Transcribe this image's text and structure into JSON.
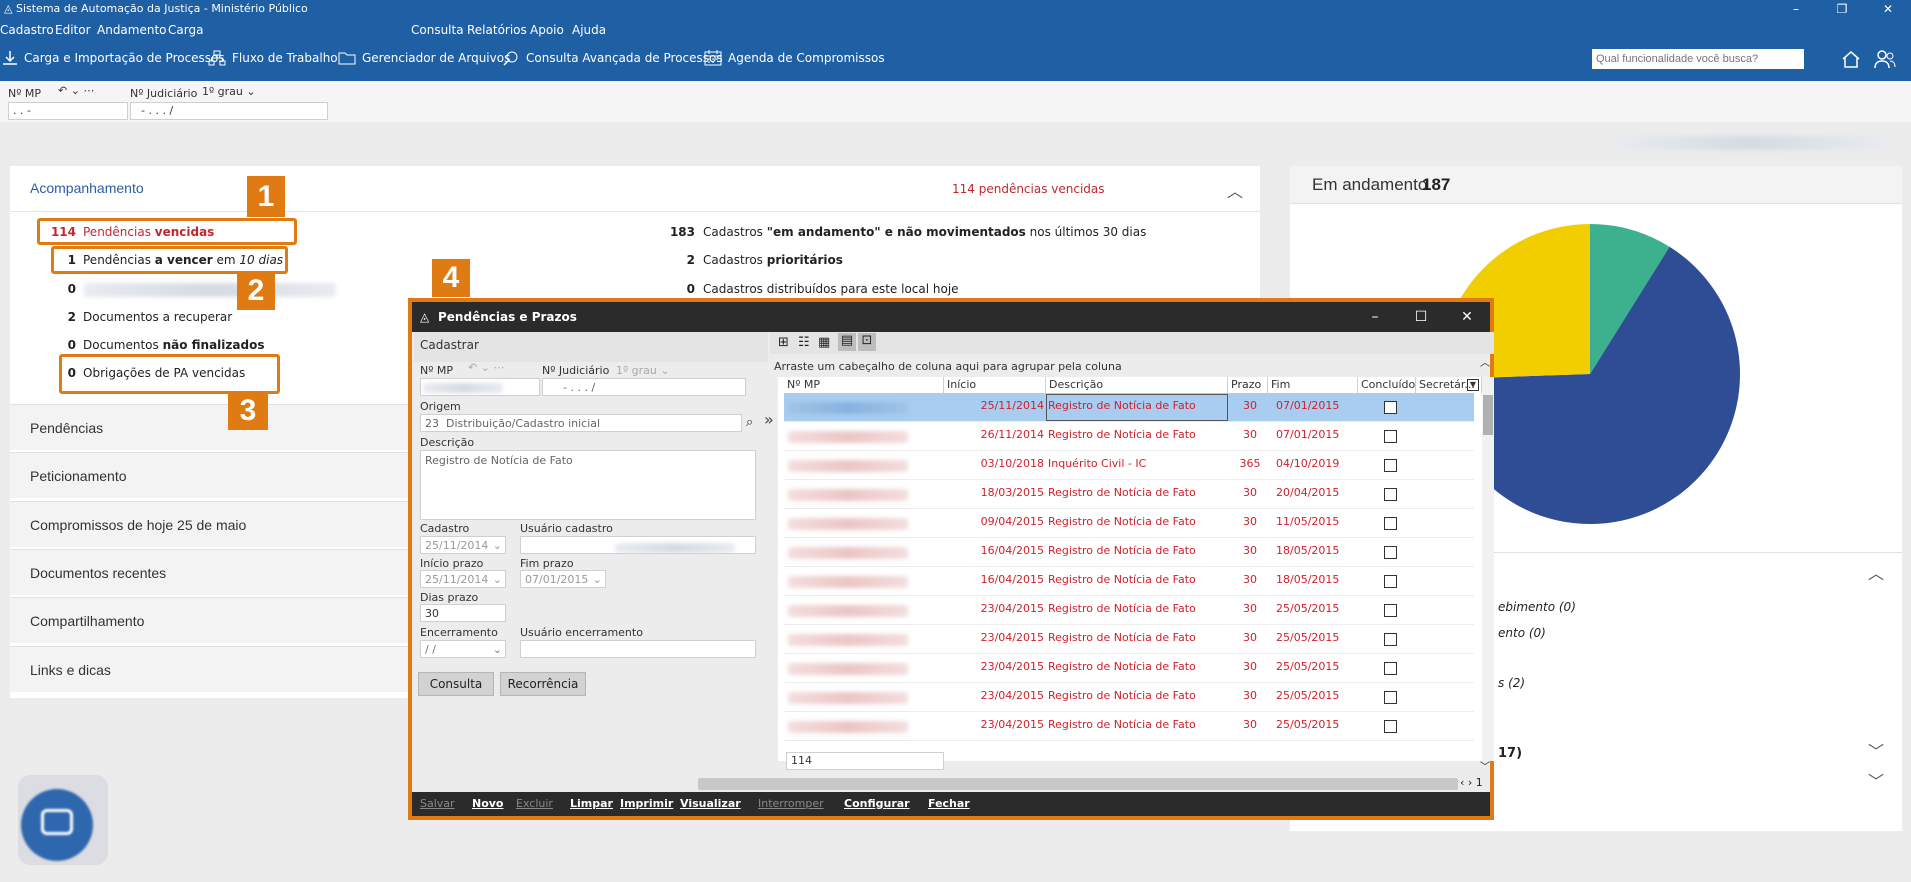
{
  "app": {
    "title": "Sistema de Automação da Justiça - Ministério Público",
    "menu_left": [
      "Cadastro",
      "Editor",
      "Andamento",
      "Carga"
    ],
    "menu_right": [
      "Consulta",
      "Relatórios",
      "Apoio",
      "Ajuda"
    ],
    "toolbar": [
      "Carga e Importação de Processos",
      "Fluxo de Trabalho",
      "Gerenciador de Arquivos",
      "Consulta Avançada de Processos",
      "Agenda de Compromissos"
    ],
    "search_placeholder": "Qual funcionalidade você busca?",
    "accent": "#1f5fa3"
  },
  "subbar": {
    "nmp_label": "Nº MP",
    "nmp_value": ". . -",
    "njud_label": "Nº Judiciário",
    "grau": "1º grau",
    "njud_value": "- . . . /"
  },
  "acomp": {
    "title": "Acompanhamento",
    "vencidas_summary": "114 pendências vencidas",
    "left": [
      {
        "num": "114",
        "text": "Pendências ",
        "bold": "vencidas"
      },
      {
        "num": "1",
        "text": "Pendências ",
        "bold": "a vencer",
        "tail": " em ",
        "ital": "10 dias"
      },
      {
        "num": "0"
      },
      {
        "num": "2",
        "text": "Documentos a recuperar"
      },
      {
        "num": "0",
        "text": "Documentos ",
        "bold": "não finalizados"
      },
      {
        "num": "0",
        "text": "Obrigações de PA vencidas"
      }
    ],
    "right": [
      {
        "num": "183",
        "text": "Cadastros ",
        "bold": "\"em andamento\" e não movimentados",
        "tail": " nos últimos 30 dias"
      },
      {
        "num": "2",
        "text": "Cadastros ",
        "bold": "prioritários"
      },
      {
        "num": "0",
        "text": "Cadastros distribuídos para este local hoje"
      }
    ]
  },
  "accordion": [
    "Pendências",
    "Peticionamento",
    "Compromissos de hoje 25 de maio",
    "Documentos recentes",
    "Compartilhamento",
    "Links e dicas"
  ],
  "callouts": [
    "1",
    "2",
    "3",
    "4"
  ],
  "right_panel": {
    "title": "Em andamento",
    "count": "187",
    "list": [
      "ebimento (0)",
      "ento (0)",
      "s (2)",
      "17)"
    ],
    "pie_colors": [
      "#2e4d94",
      "#f2cd00",
      "#3db08e"
    ]
  },
  "modal": {
    "title": "Pendências e Prazos",
    "cadastrar": "Cadastrar",
    "nmp_label": "Nº MP",
    "njud_label": "Nº Judiciário",
    "grau": "1º grau",
    "njud_value": "- . . . /",
    "origem_label": "Origem",
    "origem_code": "23",
    "origem_value": "Distribuição/Cadastro inicial",
    "descricao_label": "Descrição",
    "descricao_value": "Registro de Notícia de Fato",
    "cadastro_label": "Cadastro",
    "cadastro_value": "25/11/2014",
    "usuario_cadastro_label": "Usuário cadastro",
    "inicio_label": "Início prazo",
    "inicio_value": "25/11/2014",
    "fim_label": "Fim prazo",
    "fim_value": "07/01/2015",
    "dias_label": "Dias prazo",
    "dias_value": "30",
    "encerramento_label": "Encerramento",
    "encerramento_value": "/ /",
    "usuario_enc_label": "Usuário encerramento",
    "btn_consulta": "Consulta",
    "btn_recorrencia": "Recorrência",
    "group_hint": "Arraste um cabeçalho de coluna aqui para agrupar pela coluna",
    "columns": [
      "Nº MP",
      "Início",
      "Descrição",
      "Prazo",
      "Fim",
      "Concluído",
      "Secretár..."
    ],
    "rows": [
      {
        "inicio": "25/11/2014",
        "desc": "Registro de Notícia de Fato",
        "prazo": "30",
        "fim": "07/01/2015"
      },
      {
        "inicio": "26/11/2014",
        "desc": "Registro de Notícia de Fato",
        "prazo": "30",
        "fim": "07/01/2015"
      },
      {
        "inicio": "03/10/2018",
        "desc": "Inquérito Civil - IC",
        "prazo": "365",
        "fim": "04/10/2019"
      },
      {
        "inicio": "18/03/2015",
        "desc": "Registro de Notícia de Fato",
        "prazo": "30",
        "fim": "20/04/2015"
      },
      {
        "inicio": "09/04/2015",
        "desc": "Registro de Notícia de Fato",
        "prazo": "30",
        "fim": "11/05/2015"
      },
      {
        "inicio": "16/04/2015",
        "desc": "Registro de Notícia de Fato",
        "prazo": "30",
        "fim": "18/05/2015"
      },
      {
        "inicio": "16/04/2015",
        "desc": "Registro de Notícia de Fato",
        "prazo": "30",
        "fim": "18/05/2015"
      },
      {
        "inicio": "23/04/2015",
        "desc": "Registro de Notícia de Fato",
        "prazo": "30",
        "fim": "25/05/2015"
      },
      {
        "inicio": "23/04/2015",
        "desc": "Registro de Notícia de Fato",
        "prazo": "30",
        "fim": "25/05/2015"
      },
      {
        "inicio": "23/04/2015",
        "desc": "Registro de Notícia de Fato",
        "prazo": "30",
        "fim": "25/05/2015"
      },
      {
        "inicio": "23/04/2015",
        "desc": "Registro de Notícia de Fato",
        "prazo": "30",
        "fim": "25/05/2015"
      },
      {
        "inicio": "23/04/2015",
        "desc": "Registro de Notícia de Fato",
        "prazo": "30",
        "fim": "25/05/2015"
      }
    ],
    "count": "114",
    "page": "1",
    "footer": [
      {
        "label": "Salvar",
        "disabled": true
      },
      {
        "label": "Novo",
        "disabled": false
      },
      {
        "label": "Excluir",
        "disabled": true
      },
      {
        "label": "Limpar",
        "disabled": false
      },
      {
        "label": "Imprimir",
        "disabled": false
      },
      {
        "label": "Visualizar",
        "disabled": false
      },
      {
        "label": "Interromper",
        "disabled": true
      },
      {
        "label": "Configurar",
        "disabled": false
      },
      {
        "label": "Fechar",
        "disabled": false
      }
    ]
  }
}
